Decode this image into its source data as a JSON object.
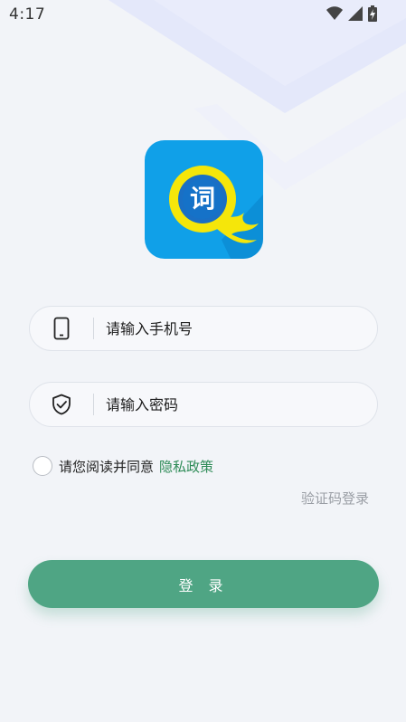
{
  "status_bar": {
    "time": "4:17",
    "icons": [
      "wifi-icon",
      "cellular-signal-icon",
      "battery-charging-icon"
    ]
  },
  "logo": {
    "glyph": "词",
    "colors": {
      "background": "#0e9ae5",
      "ring": "#f5e60a",
      "inner": "#1a6fc4"
    }
  },
  "phone_field": {
    "icon": "phone-icon",
    "placeholder": "请输入手机号",
    "value": ""
  },
  "password_field": {
    "icon": "shield-check-icon",
    "placeholder": "请输入密码",
    "value": ""
  },
  "agreement": {
    "checked": false,
    "text": "请您阅读并同意",
    "policy_link": "隐私政策"
  },
  "code_login_link": "验证码登录",
  "login_button": "登 录",
  "theme": {
    "accent": "#4fa584",
    "link": "#2e8b57",
    "background": "#f2f4f8"
  }
}
